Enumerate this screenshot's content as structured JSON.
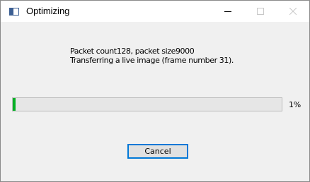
{
  "window": {
    "title": "Optimizing",
    "icon": "application-window-icon",
    "controls": [
      "minimize-icon",
      "maximize-icon",
      "close-icon"
    ]
  },
  "message": {
    "line1": "Packet count128, packet size9000",
    "line2": "Transferring a live image (frame number 31)."
  },
  "progress": {
    "value_percent": 1,
    "label": "1%",
    "fill_color": "#06b025"
  },
  "buttons": {
    "cancel_label": "Cancel"
  }
}
